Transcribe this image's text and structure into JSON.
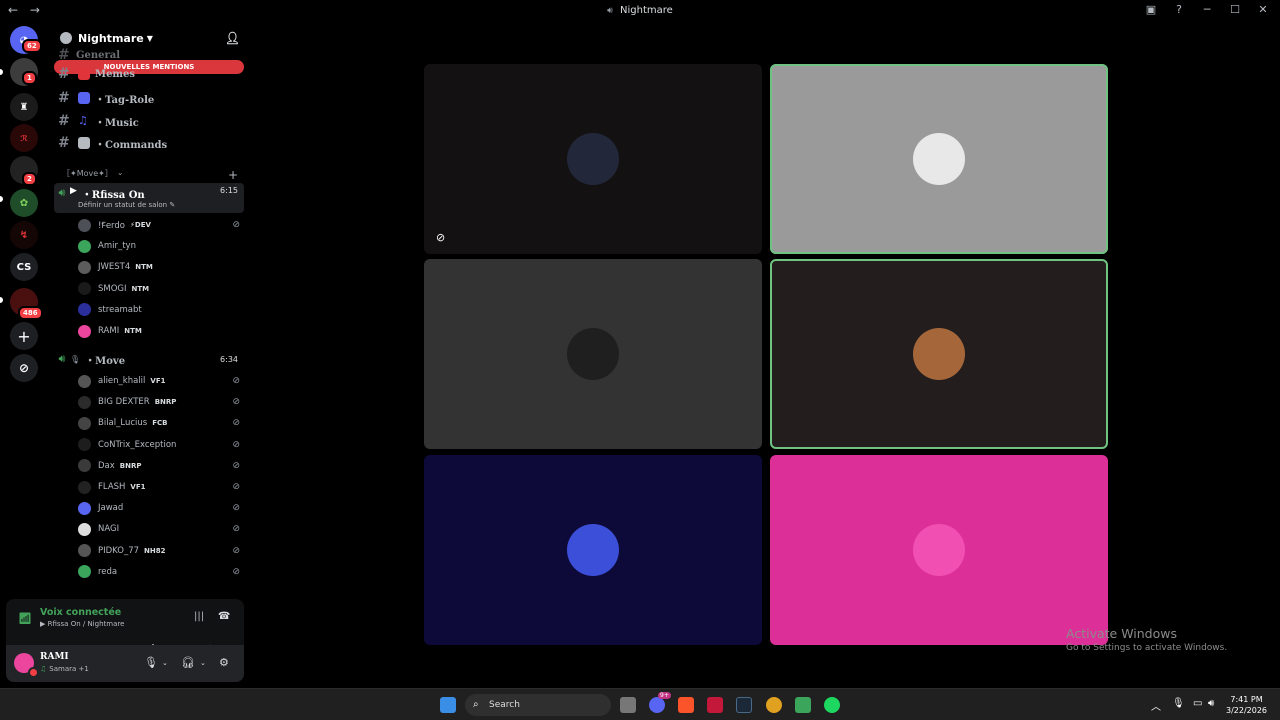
{
  "window": {
    "title": "Nightmare",
    "nav_back": "←",
    "nav_forward": "→",
    "inbox_icon": "inbox-icon",
    "help_icon": "help-icon"
  },
  "rail": {
    "dm_badge": "62",
    "servers": [
      {
        "badge": "1"
      },
      {
        "badge": ""
      },
      {
        "badge": ""
      },
      {
        "badge": "2"
      },
      {
        "badge": ""
      },
      {
        "badge": ""
      },
      {
        "label": "CS"
      },
      {
        "badge": "486"
      }
    ]
  },
  "guild": {
    "name": "Nightmare",
    "mentions_bar": "NOUVELLES MENTIONS",
    "partial_channels": [
      "General",
      "Memes"
    ],
    "text_channels": [
      {
        "name": "・Tag-Role",
        "color": "#5865f2"
      },
      {
        "name": "・Music",
        "color": "#5865f2"
      },
      {
        "name": "・Commands",
        "color": "#b5bac1"
      }
    ],
    "category": "［✦Move✦］",
    "voice_channels": [
      {
        "name": "・Rfissa On",
        "time": "6:15",
        "status": "Définir un statut de salon",
        "users": [
          {
            "name": "!Ꞙerdo",
            "tag": "⚡DEV",
            "color": "#4e5058",
            "muted": true
          },
          {
            "name": "Amir_tyn",
            "tag": "",
            "color": "#3ba55c",
            "muted": false
          },
          {
            "name": "JWEST4",
            "tag": "NTM",
            "color": "#5c5c5c",
            "muted": false
          },
          {
            "name": "SMOGI",
            "tag": "NTM",
            "color": "#1a1a1a",
            "muted": false
          },
          {
            "name": "streamabt",
            "tag": "",
            "color": "#2b2f9e",
            "muted": false
          },
          {
            "name": "RAMI",
            "tag": "NTM",
            "color": "#eb459e",
            "muted": false
          }
        ]
      },
      {
        "name": "・Move",
        "time": "6:34",
        "users": [
          {
            "name": "alien_khalil",
            "tag": "VF1",
            "color": "#555",
            "muted": true
          },
          {
            "name": "BIG DEXTER",
            "tag": "BNRP",
            "color": "#2b2b2b",
            "muted": true
          },
          {
            "name": "Bilal_Lucius",
            "tag": "FCB",
            "color": "#444",
            "muted": true
          },
          {
            "name": "CoNTrix_Exception",
            "tag": "",
            "color": "#1d1d1d",
            "muted": true
          },
          {
            "name": "Dax",
            "tag": "BNRP",
            "color": "#3a3a3a",
            "muted": true
          },
          {
            "name": "FLASH",
            "tag": "VF1",
            "color": "#222",
            "muted": true
          },
          {
            "name": "Jawad",
            "tag": "",
            "color": "#5865f2",
            "muted": true
          },
          {
            "name": "NAGI",
            "tag": "",
            "color": "#ddd",
            "muted": true
          },
          {
            "name": "PIDKO_77",
            "tag": "NH82",
            "color": "#555",
            "muted": true
          },
          {
            "name": "reda",
            "tag": "",
            "color": "#3ba55c",
            "muted": true
          }
        ]
      }
    ]
  },
  "voice_panel": {
    "title": "Voix connectée",
    "subtitle": "Rfissa On / Nightmare"
  },
  "user_panel": {
    "name": "RAMI",
    "activity": "Samara +1"
  },
  "tiles": [
    {
      "bg": "#141113",
      "avatar": "#22283a",
      "speaking": false,
      "muted": true
    },
    {
      "bg": "#9a9a9a",
      "avatar": "#e8e8e8",
      "speaking": true,
      "muted": false
    },
    {
      "bg": "#333333",
      "avatar": "#1f1f1f",
      "speaking": false,
      "muted": false
    },
    {
      "bg": "#231e1d",
      "avatar": "#a5673a",
      "speaking": true,
      "muted": false
    },
    {
      "bg": "#0d0a3a",
      "avatar": "#3c4fd8",
      "speaking": false,
      "muted": false
    },
    {
      "bg": "#dc2f97",
      "avatar": "#f14fb2",
      "speaking": false,
      "muted": false
    }
  ],
  "watermark": {
    "line1": "Activate Windows",
    "line2": "Go to Settings to activate Windows."
  },
  "taskbar": {
    "search": "Search",
    "badge": "9+",
    "time": "7:41 PM",
    "date": "3/22/2026"
  }
}
